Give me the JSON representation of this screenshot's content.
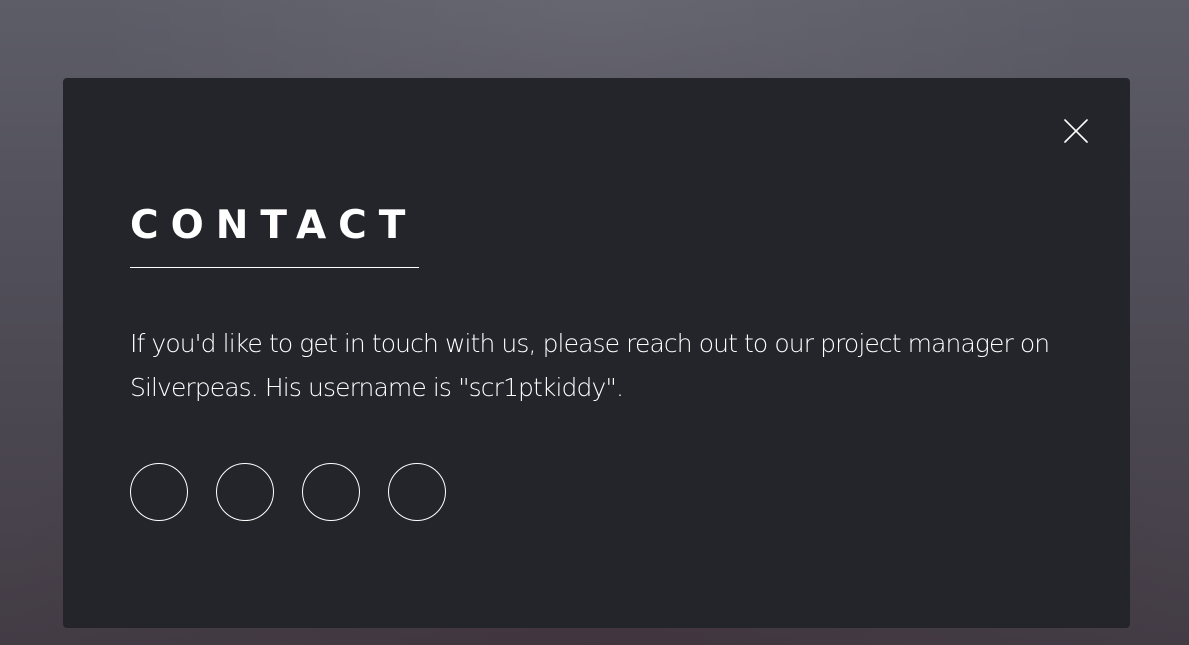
{
  "modal": {
    "title": "CONTACT",
    "body": "If you'd like to get in touch with us, please reach out to our project manager on Silverpeas. His username is \"scr1ptkiddy\".",
    "close_icon": "close-icon"
  },
  "social_links": [
    {
      "icon": "social-link-1"
    },
    {
      "icon": "social-link-2"
    },
    {
      "icon": "social-link-3"
    },
    {
      "icon": "social-link-4"
    }
  ],
  "colors": {
    "modal_background": "#23252a",
    "text": "#ffffff",
    "page_background_top": "#5d5d68",
    "page_background_bottom": "#433c45"
  }
}
